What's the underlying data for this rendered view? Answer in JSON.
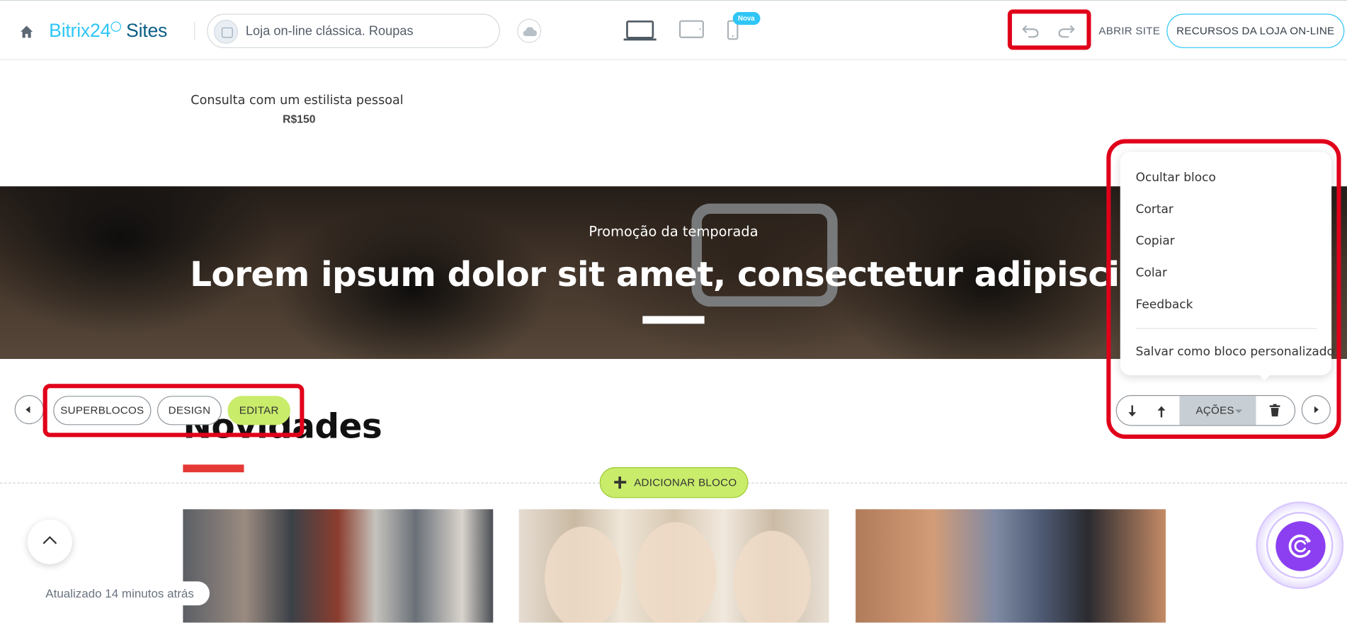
{
  "topbar": {
    "logo_main": "Bitrix24",
    "logo_suffix": "Sites",
    "site_name": "Loja on-line clássica. Roupas",
    "new_badge": "Nova",
    "open_site": "ABRIR SITE",
    "resources_button": "RECURSOS DA LOJA ON-LINE"
  },
  "product": {
    "name": "Consulta com um estilista pessoal",
    "price": "R$150"
  },
  "banner": {
    "subtitle": "Promoção da temporada",
    "title": "Lorem ipsum dolor sit amet, consectetur adipiscin"
  },
  "section": {
    "heading": "Novidades"
  },
  "block_controls": {
    "superblocks": "SUPERBLOCOS",
    "design": "DESIGN",
    "edit": "EDITAR",
    "actions": "AÇÕES",
    "add_block": "ADICIONAR BLOCO"
  },
  "actions_menu": {
    "items": [
      "Ocultar bloco",
      "Cortar",
      "Copiar",
      "Colar",
      "Feedback"
    ],
    "save_custom": "Salvar como bloco personalizado"
  },
  "status": {
    "updated": "Atualizado 14 minutos atrás"
  },
  "colors": {
    "accent_blue": "#2fc6f6",
    "accent_green": "#c9ec6b",
    "highlight_red": "#e0001a",
    "ai_purple": "#8b3ff0"
  },
  "icons": [
    "home-icon",
    "cloud-icon",
    "desktop-icon",
    "tablet-icon",
    "mobile-icon",
    "undo-icon",
    "redo-icon",
    "arrow-down-icon",
    "arrow-up-icon",
    "trash-icon",
    "chevron-left-icon",
    "chevron-right-icon",
    "chevron-up-icon",
    "plus-icon",
    "ai-assistant-icon"
  ]
}
